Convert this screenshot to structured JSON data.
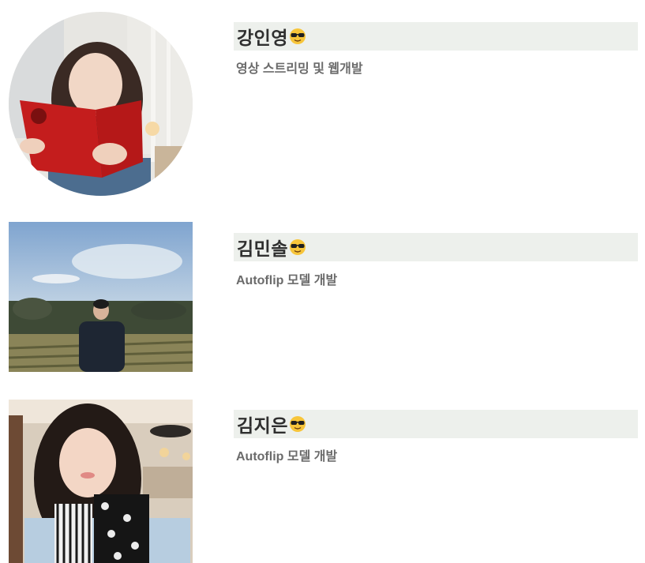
{
  "members": [
    {
      "name": "강인영",
      "emoji": "😎",
      "role": "영상 스트리밍 및 웹개발",
      "photo_icon": "profile-photo-reading-book"
    },
    {
      "name": "김민솔",
      "emoji": "😎",
      "role": "Autoflip 모델 개발",
      "photo_icon": "profile-photo-field"
    },
    {
      "name": "김지은",
      "emoji": "😎",
      "role": "Autoflip 모델 개발",
      "photo_icon": "profile-photo-selfie"
    }
  ],
  "colors": {
    "name_bar_bg": "#edf0ec",
    "name_text": "#2f2f2f",
    "role_text": "#6b6b6b"
  }
}
